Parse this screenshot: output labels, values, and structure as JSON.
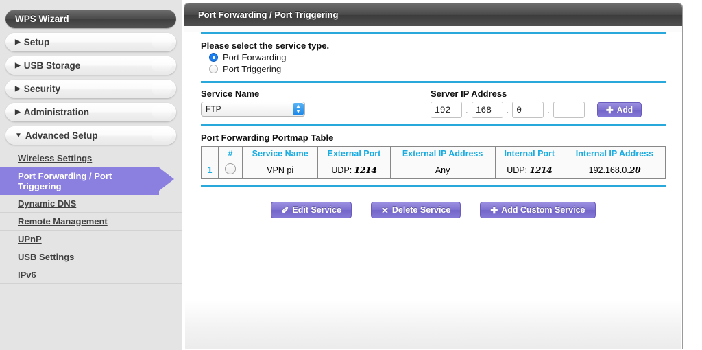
{
  "sidebar": {
    "pills": [
      {
        "label": "WPS Wizard",
        "style": "dark",
        "arrow": ""
      },
      {
        "label": "Setup",
        "style": "light",
        "arrow": "▶"
      },
      {
        "label": "USB Storage",
        "style": "light",
        "arrow": "▶"
      },
      {
        "label": "Security",
        "style": "light",
        "arrow": "▶"
      },
      {
        "label": "Administration",
        "style": "light",
        "arrow": "▶"
      },
      {
        "label": "Advanced Setup",
        "style": "light",
        "arrow": "▼"
      }
    ],
    "submenu": [
      {
        "label": "Wireless Settings",
        "active": false
      },
      {
        "label": "Port Forwarding / Port Triggering",
        "active": true
      },
      {
        "label": "Dynamic DNS",
        "active": false
      },
      {
        "label": "Remote Management",
        "active": false
      },
      {
        "label": "UPnP",
        "active": false
      },
      {
        "label": "USB Settings",
        "active": false
      },
      {
        "label": "IPv6",
        "active": false
      }
    ],
    "active_color": "#8b80e0"
  },
  "panel": {
    "title": "Port Forwarding / Port Triggering",
    "divider_color": "#29a8dc"
  },
  "service_type": {
    "heading": "Please select the service type.",
    "options": [
      {
        "label": "Port Forwarding",
        "selected": true
      },
      {
        "label": "Port Triggering",
        "selected": false
      }
    ]
  },
  "service_form": {
    "service_name_label": "Service Name",
    "service_name_value": "FTP",
    "service_name_options": [
      "FTP"
    ],
    "server_ip_label": "Server IP Address",
    "ip_octets": [
      "192",
      "168",
      "0",
      ""
    ],
    "ip_separator": ".",
    "add_button": {
      "label": "Add",
      "icon": "plus-icon",
      "glyph": "➕"
    }
  },
  "portmap": {
    "title": "Port Forwarding Portmap Table",
    "columns": [
      "",
      "#",
      "Service Name",
      "External Port",
      "External IP Address",
      "Internal Port",
      "Internal IP Address"
    ],
    "header_color": "#1aace0",
    "rows": [
      {
        "num": "1",
        "service_name": "VPN pi",
        "external_port_proto": "UDP:",
        "external_port_value": "1214",
        "external_ip": "Any",
        "internal_port_proto": "UDP:",
        "internal_port_value": "1214",
        "internal_ip_prefix": "192.168.0.",
        "internal_ip_last": "20",
        "selected": false
      }
    ]
  },
  "actions": [
    {
      "label": "Edit Service",
      "icon": "pencil-icon",
      "glyph": "✎"
    },
    {
      "label": "Delete Service",
      "icon": "x-icon",
      "glyph": "✕"
    },
    {
      "label": "Add Custom Service",
      "icon": "plus-icon",
      "glyph": "➕"
    }
  ]
}
